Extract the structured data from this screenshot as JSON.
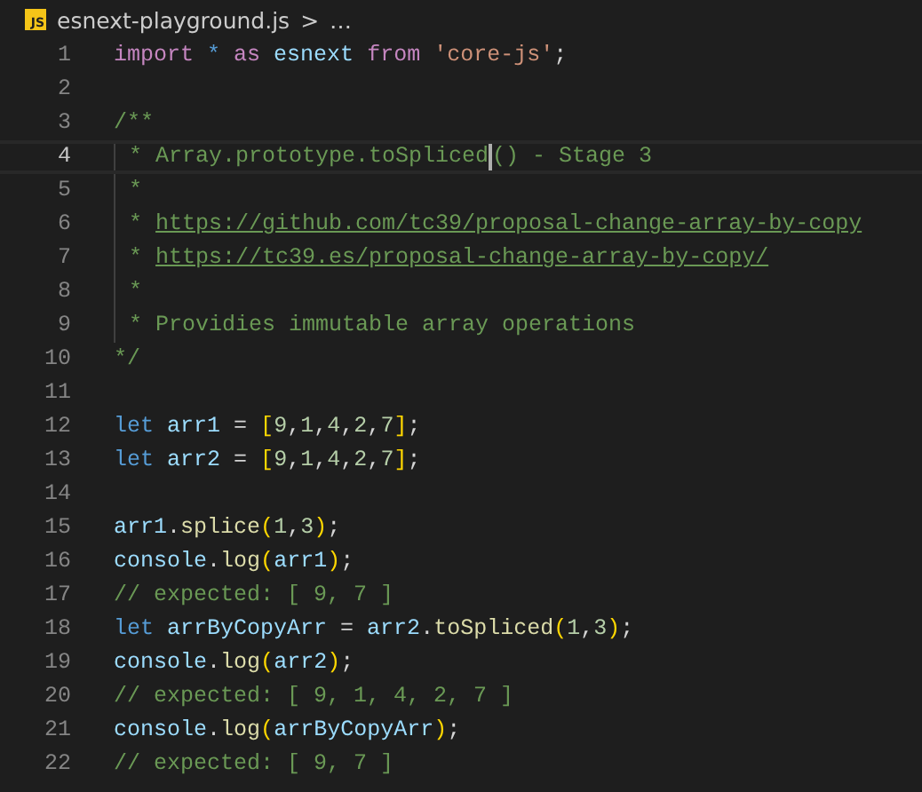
{
  "breadcrumb": {
    "file_icon": "JS",
    "file_name": "esnext-playground.js",
    "separator": ">",
    "ellipsis": "…"
  },
  "lines": [
    {
      "number": "1",
      "current": false,
      "indent_guide": false,
      "tokens": [
        {
          "kind": "keyword",
          "text": "import "
        },
        {
          "kind": "storage",
          "text": "* "
        },
        {
          "kind": "keyword",
          "text": "as "
        },
        {
          "kind": "variable",
          "text": "esnext "
        },
        {
          "kind": "keyword",
          "text": "from "
        },
        {
          "kind": "string",
          "text": "'core-js'"
        },
        {
          "kind": "plain",
          "text": ";"
        }
      ]
    },
    {
      "number": "2",
      "current": false,
      "indent_guide": false
    },
    {
      "number": "3",
      "current": false,
      "indent_guide": false,
      "tokens": [
        {
          "kind": "comment",
          "text": "/**"
        }
      ]
    },
    {
      "number": "4",
      "current": true,
      "indent_guide": true,
      "tokens": [
        {
          "kind": "comment",
          "text": " * Array.prototype.toSpliced"
        },
        {
          "kind": "cursor"
        },
        {
          "kind": "comment",
          "text": "() - Stage 3"
        }
      ]
    },
    {
      "number": "5",
      "current": false,
      "indent_guide": true,
      "tokens": [
        {
          "kind": "comment",
          "text": " *"
        }
      ]
    },
    {
      "number": "6",
      "current": false,
      "indent_guide": true,
      "tokens": [
        {
          "kind": "comment",
          "text": " * "
        },
        {
          "kind": "link",
          "text": "https://github.com/tc39/proposal-change-array-by-copy"
        }
      ]
    },
    {
      "number": "7",
      "current": false,
      "indent_guide": true,
      "tokens": [
        {
          "kind": "comment",
          "text": " * "
        },
        {
          "kind": "link",
          "text": "https://tc39.es/proposal-change-array-by-copy/"
        }
      ]
    },
    {
      "number": "8",
      "current": false,
      "indent_guide": true,
      "tokens": [
        {
          "kind": "comment",
          "text": " *"
        }
      ]
    },
    {
      "number": "9",
      "current": false,
      "indent_guide": true,
      "tokens": [
        {
          "kind": "comment",
          "text": " * Providies immutable array operations"
        }
      ]
    },
    {
      "number": "10",
      "current": false,
      "indent_guide": false,
      "tokens": [
        {
          "kind": "comment",
          "text": "*/"
        }
      ]
    },
    {
      "number": "11",
      "current": false,
      "indent_guide": false
    },
    {
      "number": "12",
      "current": false,
      "indent_guide": false,
      "tokens": [
        {
          "kind": "storage",
          "text": "let "
        },
        {
          "kind": "variable",
          "text": "arr1"
        },
        {
          "kind": "plain",
          "text": " = "
        },
        {
          "kind": "bracket",
          "text": "["
        },
        {
          "kind": "number",
          "text": "9"
        },
        {
          "kind": "plain",
          "text": ","
        },
        {
          "kind": "number",
          "text": "1"
        },
        {
          "kind": "plain",
          "text": ","
        },
        {
          "kind": "number",
          "text": "4"
        },
        {
          "kind": "plain",
          "text": ","
        },
        {
          "kind": "number",
          "text": "2"
        },
        {
          "kind": "plain",
          "text": ","
        },
        {
          "kind": "number",
          "text": "7"
        },
        {
          "kind": "bracket",
          "text": "]"
        },
        {
          "kind": "plain",
          "text": ";"
        }
      ]
    },
    {
      "number": "13",
      "current": false,
      "indent_guide": false,
      "tokens": [
        {
          "kind": "storage",
          "text": "let "
        },
        {
          "kind": "variable",
          "text": "arr2"
        },
        {
          "kind": "plain",
          "text": " = "
        },
        {
          "kind": "bracket",
          "text": "["
        },
        {
          "kind": "number",
          "text": "9"
        },
        {
          "kind": "plain",
          "text": ","
        },
        {
          "kind": "number",
          "text": "1"
        },
        {
          "kind": "plain",
          "text": ","
        },
        {
          "kind": "number",
          "text": "4"
        },
        {
          "kind": "plain",
          "text": ","
        },
        {
          "kind": "number",
          "text": "2"
        },
        {
          "kind": "plain",
          "text": ","
        },
        {
          "kind": "number",
          "text": "7"
        },
        {
          "kind": "bracket",
          "text": "]"
        },
        {
          "kind": "plain",
          "text": ";"
        }
      ]
    },
    {
      "number": "14",
      "current": false,
      "indent_guide": false
    },
    {
      "number": "15",
      "current": false,
      "indent_guide": false,
      "tokens": [
        {
          "kind": "variable",
          "text": "arr1"
        },
        {
          "kind": "plain",
          "text": "."
        },
        {
          "kind": "function",
          "text": "splice"
        },
        {
          "kind": "bracket",
          "text": "("
        },
        {
          "kind": "number",
          "text": "1"
        },
        {
          "kind": "plain",
          "text": ","
        },
        {
          "kind": "number",
          "text": "3"
        },
        {
          "kind": "bracket",
          "text": ")"
        },
        {
          "kind": "plain",
          "text": ";"
        }
      ]
    },
    {
      "number": "16",
      "current": false,
      "indent_guide": false,
      "tokens": [
        {
          "kind": "variable",
          "text": "console"
        },
        {
          "kind": "plain",
          "text": "."
        },
        {
          "kind": "function",
          "text": "log"
        },
        {
          "kind": "bracket",
          "text": "("
        },
        {
          "kind": "variable",
          "text": "arr1"
        },
        {
          "kind": "bracket",
          "text": ")"
        },
        {
          "kind": "plain",
          "text": ";"
        }
      ]
    },
    {
      "number": "17",
      "current": false,
      "indent_guide": false,
      "tokens": [
        {
          "kind": "comment",
          "text": "// expected: [ 9, 7 ]"
        }
      ]
    },
    {
      "number": "18",
      "current": false,
      "indent_guide": false,
      "tokens": [
        {
          "kind": "storage",
          "text": "let "
        },
        {
          "kind": "variable",
          "text": "arrByCopyArr"
        },
        {
          "kind": "plain",
          "text": " = "
        },
        {
          "kind": "variable",
          "text": "arr2"
        },
        {
          "kind": "plain",
          "text": "."
        },
        {
          "kind": "function",
          "text": "toSpliced"
        },
        {
          "kind": "bracket",
          "text": "("
        },
        {
          "kind": "number",
          "text": "1"
        },
        {
          "kind": "plain",
          "text": ","
        },
        {
          "kind": "number",
          "text": "3"
        },
        {
          "kind": "bracket",
          "text": ")"
        },
        {
          "kind": "plain",
          "text": ";"
        }
      ]
    },
    {
      "number": "19",
      "current": false,
      "indent_guide": false,
      "tokens": [
        {
          "kind": "variable",
          "text": "console"
        },
        {
          "kind": "plain",
          "text": "."
        },
        {
          "kind": "function",
          "text": "log"
        },
        {
          "kind": "bracket",
          "text": "("
        },
        {
          "kind": "variable",
          "text": "arr2"
        },
        {
          "kind": "bracket",
          "text": ")"
        },
        {
          "kind": "plain",
          "text": ";"
        }
      ]
    },
    {
      "number": "20",
      "current": false,
      "indent_guide": false,
      "tokens": [
        {
          "kind": "comment",
          "text": "// expected: [ 9, 1, 4, 2, 7 ]"
        }
      ]
    },
    {
      "number": "21",
      "current": false,
      "indent_guide": false,
      "tokens": [
        {
          "kind": "variable",
          "text": "console"
        },
        {
          "kind": "plain",
          "text": "."
        },
        {
          "kind": "function",
          "text": "log"
        },
        {
          "kind": "bracket",
          "text": "("
        },
        {
          "kind": "variable",
          "text": "arrByCopyArr"
        },
        {
          "kind": "bracket",
          "text": ")"
        },
        {
          "kind": "plain",
          "text": ";"
        }
      ]
    },
    {
      "number": "22",
      "current": false,
      "indent_guide": false,
      "tokens": [
        {
          "kind": "comment",
          "text": "// expected: [ 9, 7 ]"
        }
      ]
    }
  ]
}
